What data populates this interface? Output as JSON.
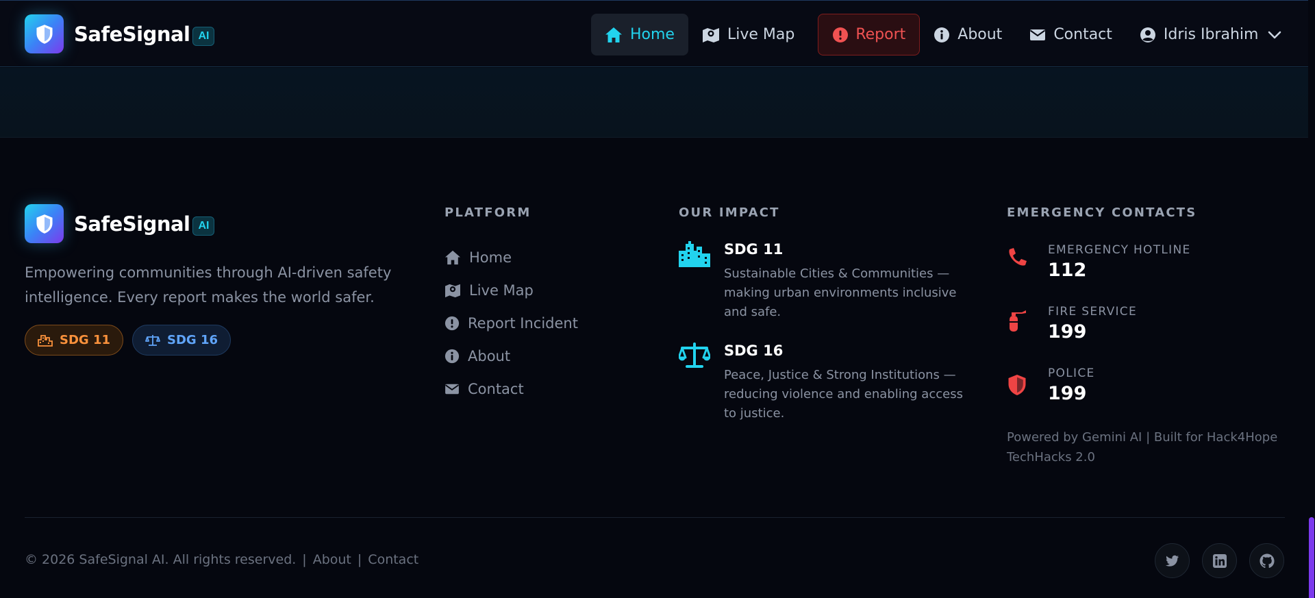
{
  "header": {
    "brand": "SafeSignal",
    "brand_badge": "AI",
    "nav": {
      "home": "Home",
      "live_map": "Live Map",
      "report": "Report",
      "about": "About",
      "contact": "Contact",
      "user": "Idris Ibrahim"
    }
  },
  "footer": {
    "brand": "SafeSignal",
    "brand_badge": "AI",
    "description": "Empowering communities through AI-driven safety intelligence. Every report makes the world safer.",
    "pills": [
      "SDG 11",
      "SDG 16"
    ],
    "platform": {
      "heading": "PLATFORM",
      "items": [
        "Home",
        "Live Map",
        "Report Incident",
        "About",
        "Contact"
      ]
    },
    "impact": {
      "heading": "OUR IMPACT",
      "items": [
        {
          "title": "SDG 11",
          "desc": "Sustainable Cities & Communities — making urban environments inclusive and safe."
        },
        {
          "title": "SDG 16",
          "desc": "Peace, Justice & Strong Institutions — reducing violence and enabling access to justice."
        }
      ]
    },
    "emergency": {
      "heading": "EMERGENCY CONTACTS",
      "items": [
        {
          "label": "EMERGENCY HOTLINE",
          "number": "112"
        },
        {
          "label": "FIRE SERVICE",
          "number": "199"
        },
        {
          "label": "POLICE",
          "number": "199"
        }
      ],
      "powered": "Powered by Gemini AI | Built for Hack4Hope TechHacks 2.0"
    },
    "copyright": "© 2026 SafeSignal AI. All rights reserved.",
    "bottom_links": [
      "About",
      "Contact"
    ],
    "socials": [
      "twitter-icon",
      "linkedin-icon",
      "github-icon"
    ]
  },
  "colors": {
    "accent": "#22d3ee",
    "danger": "#ef4444",
    "orange": "#fb923c",
    "blue": "#60a5fa",
    "scroll_thumb": "#7c3aed"
  }
}
